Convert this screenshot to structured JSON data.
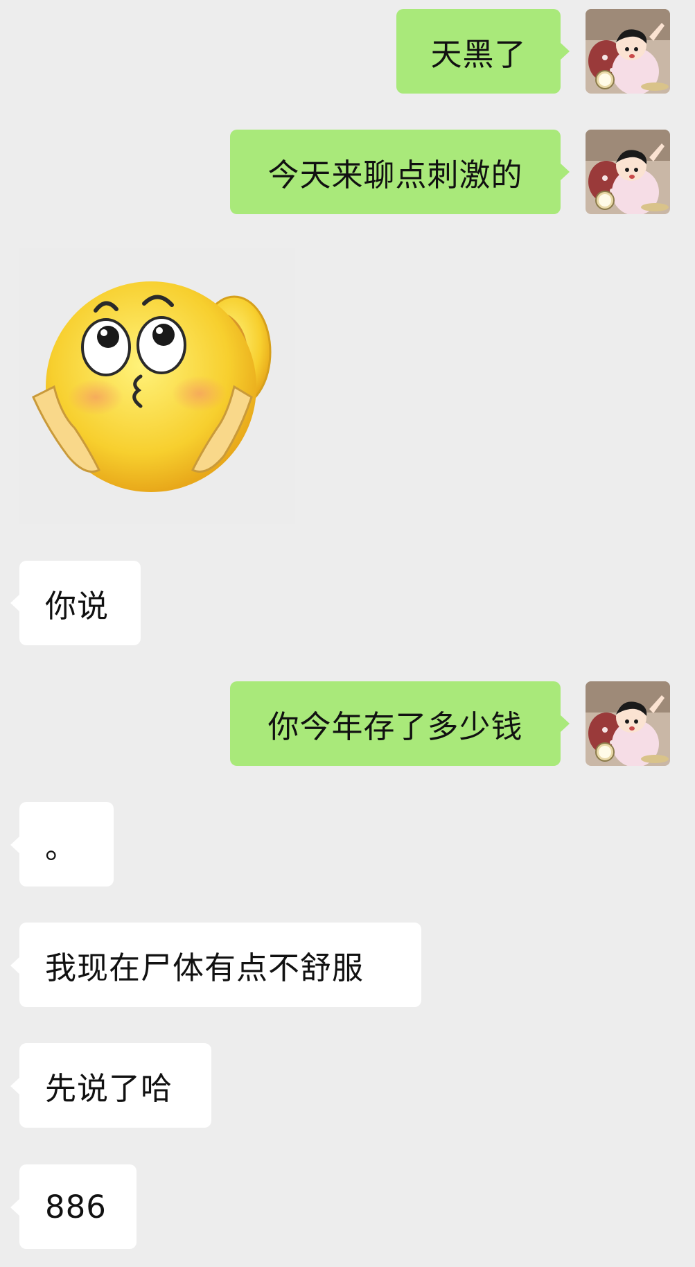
{
  "conversation": {
    "messages": [
      {
        "side": "out",
        "text": "天黑了"
      },
      {
        "side": "out",
        "text": "今天来聊点刺激的"
      },
      {
        "side": "in",
        "type": "sticker",
        "sticker": "ear-listening-emoji"
      },
      {
        "side": "in",
        "text": "你说"
      },
      {
        "side": "out",
        "text": "你今年存了多少钱"
      },
      {
        "side": "in",
        "text": "。"
      },
      {
        "side": "in",
        "text": "我现在尸体有点不舒服"
      },
      {
        "side": "in",
        "text": "先说了哈"
      },
      {
        "side": "in",
        "text": "886"
      }
    ]
  },
  "colors": {
    "background": "#ededed",
    "outgoing_bubble": "#a9e97a",
    "incoming_bubble": "#ffffff"
  },
  "icons": {
    "avatar": "cartoon-avatar",
    "sticker": "ear-listening-emoji"
  }
}
